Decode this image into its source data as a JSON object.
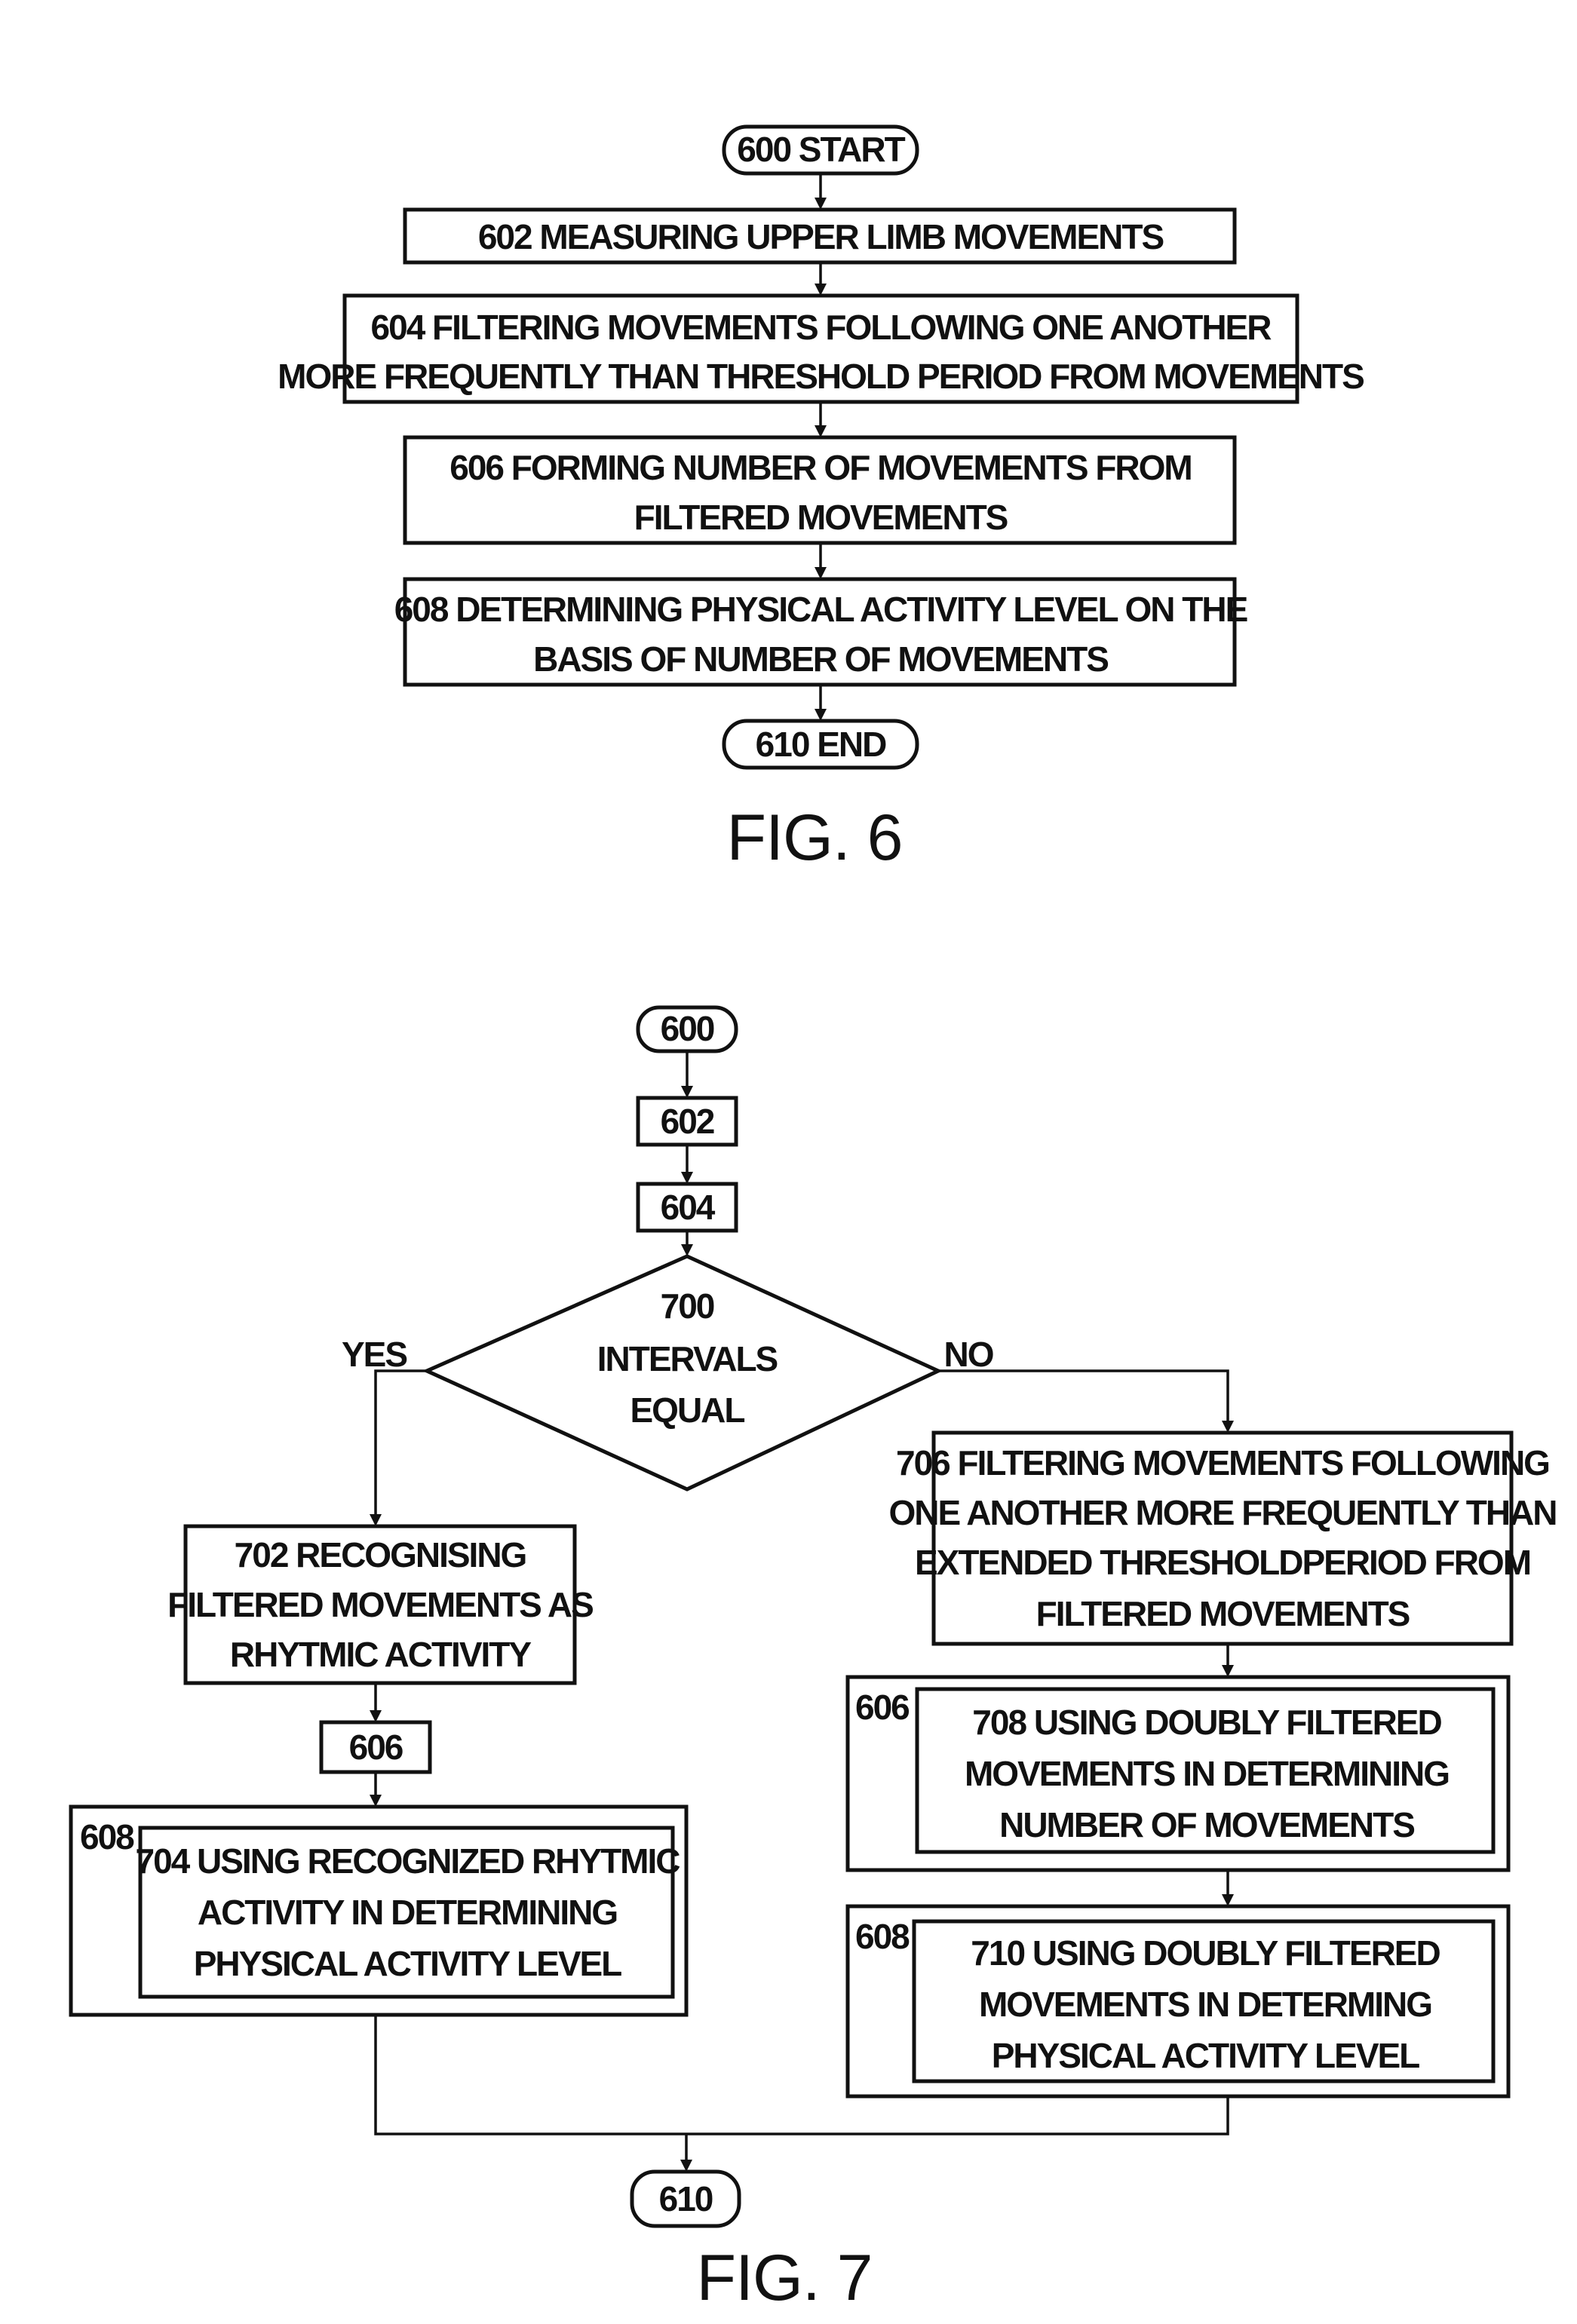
{
  "fig6": {
    "caption": "FIG. 6",
    "start": "600 START",
    "s602": [
      "602 MEASURING UPPER LIMB MOVEMENTS"
    ],
    "s604": [
      "604 FILTERING MOVEMENTS FOLLOWING ONE ANOTHER",
      "MORE FREQUENTLY THAN THRESHOLD PERIOD FROM MOVEMENTS"
    ],
    "s606": [
      "606 FORMING NUMBER OF MOVEMENTS FROM",
      "FILTERED MOVEMENTS"
    ],
    "s608": [
      "608 DETERMINING PHYSICAL ACTIVITY LEVEL ON THE",
      "BASIS OF NUMBER OF MOVEMENTS"
    ],
    "end": "610 END"
  },
  "fig7": {
    "caption": "FIG. 7",
    "start": "600",
    "s602": "602",
    "s604": "604",
    "decision": [
      "700",
      "INTERVALS",
      "EQUAL"
    ],
    "yes_label": "YES",
    "no_label": "NO",
    "s702": [
      "702 RECOGNISING",
      "FILTERED MOVEMENTS AS",
      "RHYTMIC ACTIVITY"
    ],
    "left_606": "606",
    "left_608_label": "608",
    "s704": [
      "704 USING RECOGNIZED RHYTMIC",
      "ACTIVITY IN DETERMINING",
      "PHYSICAL ACTIVITY LEVEL"
    ],
    "s706": [
      "706 FILTERING MOVEMENTS FOLLOWING",
      "ONE ANOTHER MORE FREQUENTLY THAN",
      "EXTENDED THRESHOLDPERIOD FROM",
      "FILTERED MOVEMENTS"
    ],
    "right_606_label": "606",
    "s708": [
      "708 USING DOUBLY FILTERED",
      "MOVEMENTS IN DETERMINING",
      "NUMBER OF MOVEMENTS"
    ],
    "right_608_label": "608",
    "s710": [
      "710 USING DOUBLY FILTERED",
      "MOVEMENTS IN DETERMING",
      "PHYSICAL ACTIVITY LEVEL"
    ],
    "end": "610"
  }
}
